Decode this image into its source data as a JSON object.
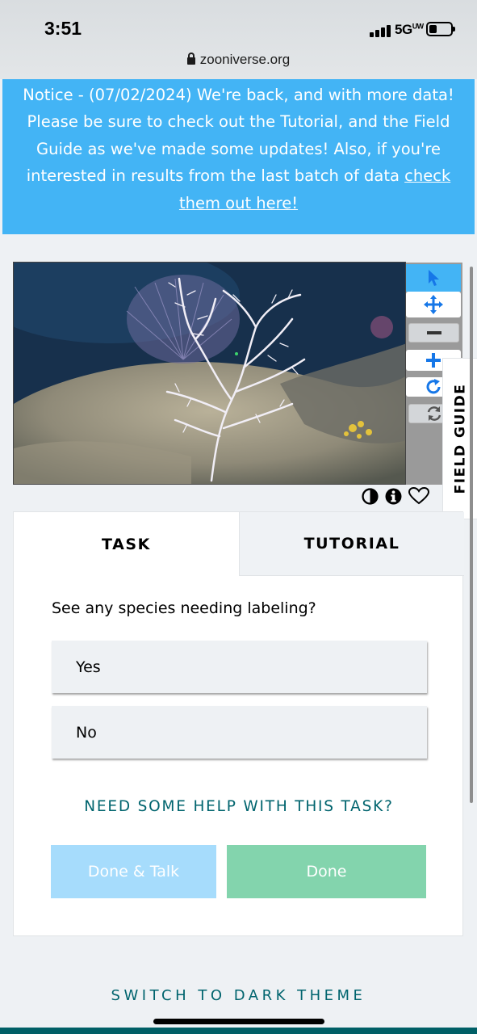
{
  "status_bar": {
    "time": "3:51",
    "network": "5G",
    "network_superscript": "UW"
  },
  "browser": {
    "url": "zooniverse.org"
  },
  "notice": {
    "text": "Notice - (07/02/2024) We're back, and with more data! Please be sure to check out the Tutorial, and the Field Guide as we've made some updates! Also, if you're interested in results from the last batch of data ",
    "link_text": "check them out here!"
  },
  "viewer": {
    "tools": [
      {
        "icon": "pointer-icon",
        "active": true
      },
      {
        "icon": "move-icon",
        "active": false
      },
      {
        "icon": "zoom-out-icon",
        "active": false
      },
      {
        "icon": "zoom-in-icon",
        "active": false
      },
      {
        "icon": "rotate-icon",
        "active": false
      },
      {
        "icon": "reset-icon",
        "active": false
      }
    ],
    "meta_icons": [
      "contrast-icon",
      "info-icon",
      "heart-icon"
    ]
  },
  "field_guide": {
    "label": "FIELD GUIDE"
  },
  "task_panel": {
    "tabs": [
      {
        "label": "TASK",
        "active": true
      },
      {
        "label": "TUTORIAL",
        "active": false
      }
    ],
    "question": "See any species needing labeling?",
    "answers": [
      "Yes",
      "No"
    ],
    "help_link": "NEED SOME HELP WITH THIS TASK?",
    "done_talk_label": "Done & Talk",
    "done_label": "Done"
  },
  "footer": {
    "theme_switch": "SWITCH TO DARK THEME"
  },
  "colors": {
    "accent_blue": "#43b4f5",
    "teal": "#00646e",
    "done_green": "#83d4ad",
    "talk_blue": "#a6dcfc"
  }
}
